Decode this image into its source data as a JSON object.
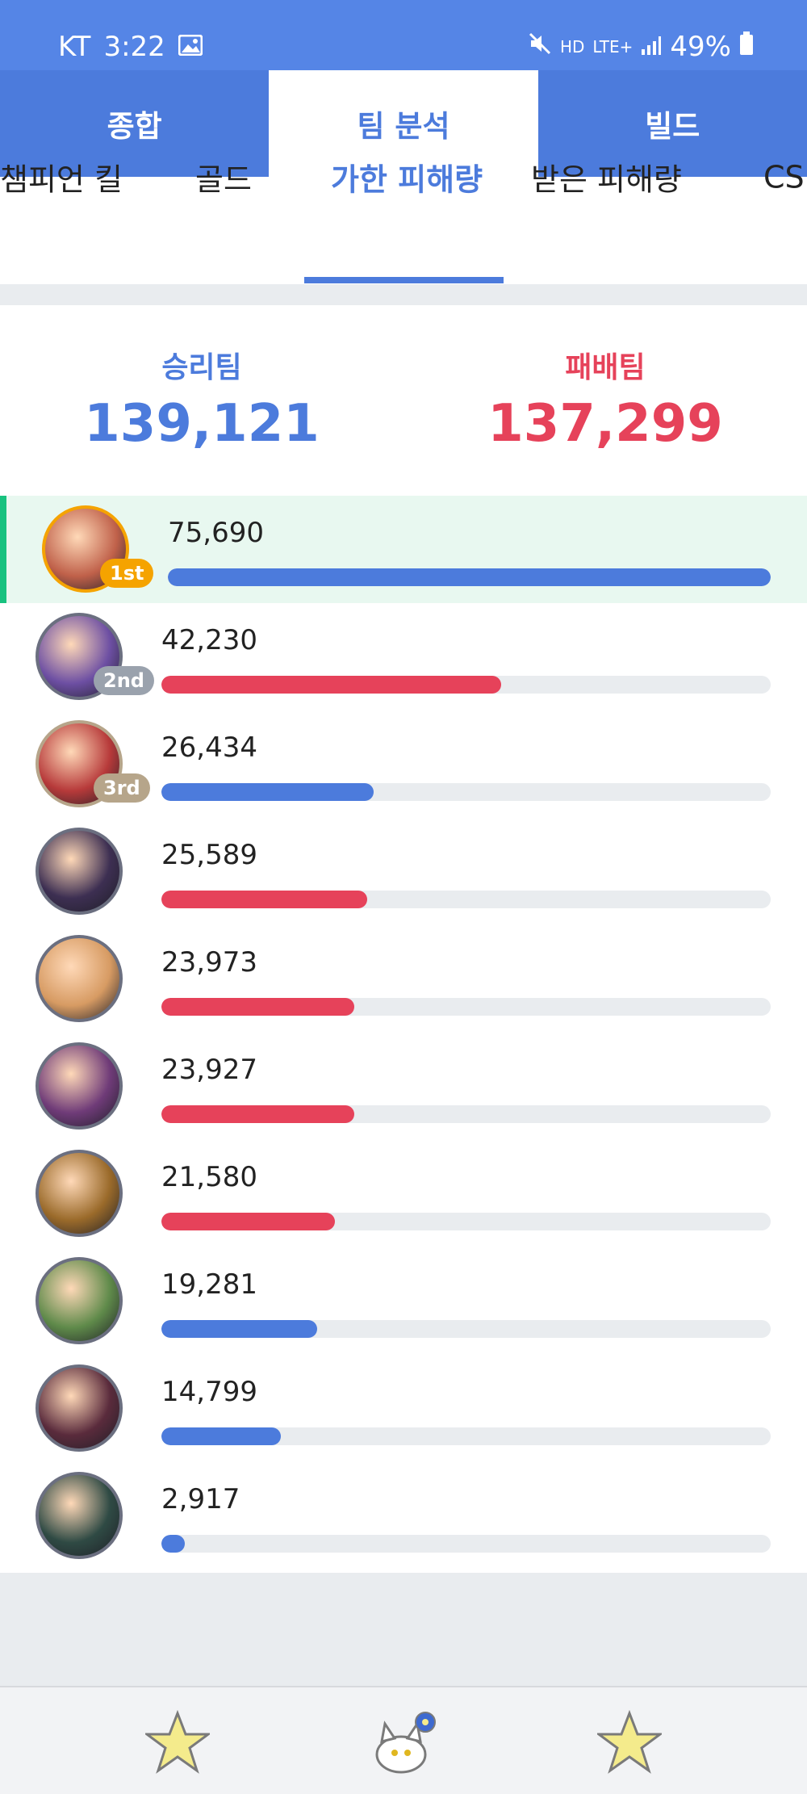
{
  "status_bar": {
    "carrier": "KT",
    "time": "3:22",
    "battery": "49%",
    "network": "LTE+",
    "hd": "HD"
  },
  "top_tabs": [
    {
      "label": "종합",
      "active": false
    },
    {
      "label": "팀 분석",
      "active": true
    },
    {
      "label": "빌드",
      "active": false
    }
  ],
  "sub_tabs": [
    {
      "label": "챔피언 킬",
      "active": false
    },
    {
      "label": "골드",
      "active": false
    },
    {
      "label": "가한 피해량",
      "active": true
    },
    {
      "label": "받은 피해량",
      "active": false
    },
    {
      "label": "CS",
      "active": false
    }
  ],
  "summary": {
    "win_label": "승리팀",
    "win_value": "139,121",
    "lose_label": "패배팀",
    "lose_value": "137,299"
  },
  "colors": {
    "win": "#4c7bdc",
    "lose": "#e6425a",
    "highlight": "#18c27f",
    "gold_badge": "#f5a300",
    "silver_badge": "#9aa2ad",
    "bronze_badge": "#b6a58a"
  },
  "rows": [
    {
      "damage": "75,690",
      "fraction": 1.0,
      "team": "win",
      "rank": "1st",
      "highlight": true,
      "avatar_color": "#c0614a"
    },
    {
      "damage": "42,230",
      "fraction": 0.558,
      "team": "lose",
      "rank": "2nd",
      "highlight": false,
      "avatar_color": "#6d4fa3"
    },
    {
      "damage": "26,434",
      "fraction": 0.349,
      "team": "win",
      "rank": "3rd",
      "highlight": false,
      "avatar_color": "#b73a3a"
    },
    {
      "damage": "25,589",
      "fraction": 0.338,
      "team": "lose",
      "rank": "",
      "highlight": false,
      "avatar_color": "#3d2f52"
    },
    {
      "damage": "23,973",
      "fraction": 0.317,
      "team": "lose",
      "rank": "",
      "highlight": false,
      "avatar_color": "#d79b63"
    },
    {
      "damage": "23,927",
      "fraction": 0.316,
      "team": "lose",
      "rank": "",
      "highlight": false,
      "avatar_color": "#6f3b78"
    },
    {
      "damage": "21,580",
      "fraction": 0.285,
      "team": "lose",
      "rank": "",
      "highlight": false,
      "avatar_color": "#9a6a2a"
    },
    {
      "damage": "19,281",
      "fraction": 0.255,
      "team": "win",
      "rank": "",
      "highlight": false,
      "avatar_color": "#5f8a4a"
    },
    {
      "damage": "14,799",
      "fraction": 0.196,
      "team": "win",
      "rank": "",
      "highlight": false,
      "avatar_color": "#5a2b3c"
    },
    {
      "damage": "2,917",
      "fraction": 0.039,
      "team": "win",
      "rank": "",
      "highlight": false,
      "avatar_color": "#2f4a44"
    }
  ],
  "bottom_nav": [
    {
      "icon": "star-icon"
    },
    {
      "icon": "cat-mascot-icon"
    },
    {
      "icon": "star-icon"
    }
  ]
}
